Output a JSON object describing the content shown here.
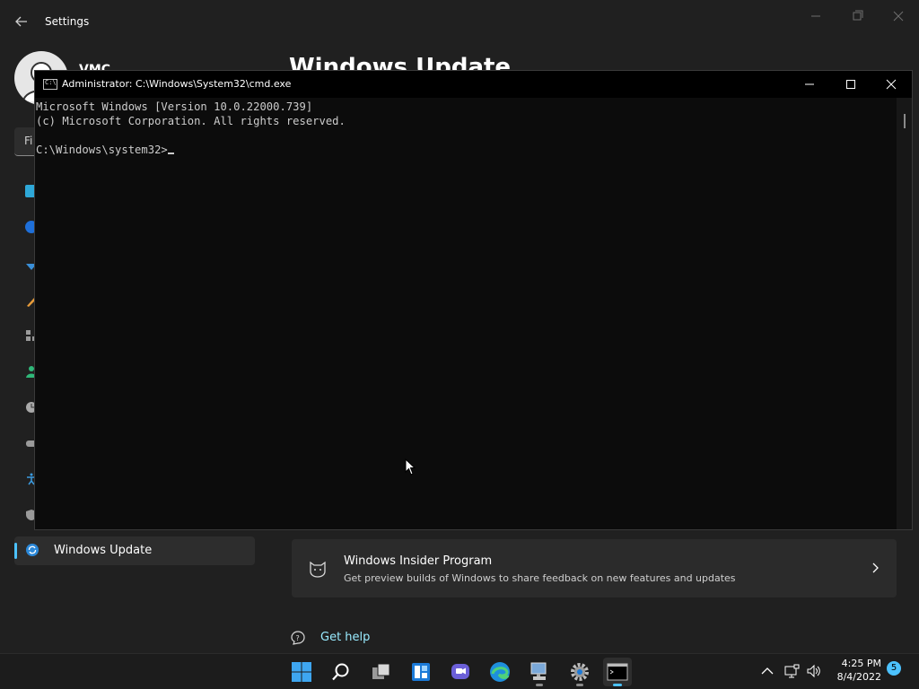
{
  "settings": {
    "app_title": "Settings",
    "profile_name": "VMC",
    "page_heading": "Windows Update",
    "find_placeholder": "Fi",
    "active_nav_label": "Windows Update",
    "card": {
      "title": "Windows Insider Program",
      "subtitle": "Get preview builds of Windows to share feedback on new features and updates"
    },
    "help_link": "Get help"
  },
  "cmd": {
    "title": "Administrator: C:\\Windows\\System32\\cmd.exe",
    "icon_text": "C:\\",
    "lines": [
      "Microsoft Windows [Version 10.0.22000.739]",
      "(c) Microsoft Corporation. All rights reserved.",
      "",
      "C:\\Windows\\system32>"
    ]
  },
  "taskbar": {
    "time": "4:25 PM",
    "date": "8/4/2022",
    "notification_count": "5"
  },
  "colors": {
    "accent": "#4cc2ff",
    "link": "#99ebff",
    "terminal_text": "#cccccc"
  }
}
